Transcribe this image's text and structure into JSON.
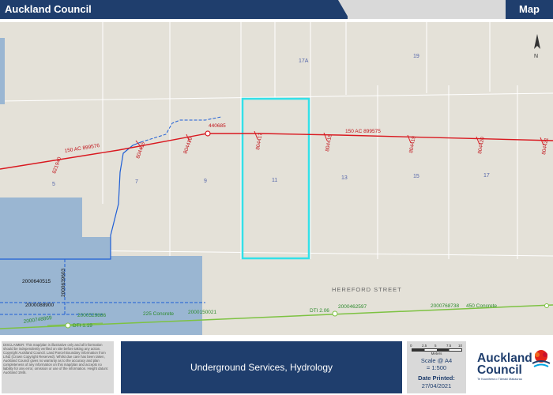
{
  "header": {
    "title": "Auckland Council",
    "tab_label": "Map"
  },
  "map": {
    "north_arrow_label": "N",
    "parcels": [
      "17A",
      "19",
      "5",
      "7",
      "9",
      "11",
      "13",
      "15",
      "17"
    ],
    "street_name": "HEREFORD STREET",
    "assets": {
      "a440685": "440685",
      "wastewater_west": "150 AC   899576",
      "wastewater_east": "150 AC   899575",
      "m821940": "821940",
      "m804415": "804415",
      "m804416": "804416",
      "m804417": "804417",
      "m804418": "804418",
      "m804419": "804419",
      "m804420": "804420",
      "m804421": "804421",
      "s2000640515": "2000640515",
      "s2000088900": "2000088900",
      "s2000639603": "2000639603",
      "w2000529886": "2000529886",
      "w225concrete": "225 Concrete",
      "w2000150021": "2000150021",
      "wdti206": "DTI 2.06",
      "w2000462597": "2000462597",
      "w2000768738": "2000768738",
      "w450concrete": "450 Concrete",
      "w2000748869": "2000748869",
      "wdti119": "DTI 1.19"
    },
    "colors": {
      "background": "#e4e1d8",
      "parcel_lines": "#ffffff",
      "water_area": "#9ab6d2",
      "wastewater": "#d9181f",
      "stormwater": "#1f5fd6",
      "water_supply": "#7dc242",
      "highlight": "#33e0e8"
    }
  },
  "footer": {
    "disclaimer": "DISCLAIMER: This map/plan is illustrative only and all information should be independently verified on site before taking any action. Copyright Auckland Council. Land Parcel Boundary information from LINZ (Crown Copyright Reserved). Whilst due care has been taken, Auckland Council gives no warranty as to the accuracy and plan completeness of any information on this map/plan and accepts no liability for any error, omission or use of the information. Height datum: Auckland 1946.",
    "title": "Underground Services, Hydrology",
    "scalebar_ticks": [
      "0",
      "2.5",
      "5",
      "7.5",
      "10"
    ],
    "scalebar_unit": "Meters",
    "scale_label": "Scale @ A4",
    "scale_value": "= 1:500",
    "date_label": "Date Printed:",
    "date_value": "27/04/2021",
    "logo_line1": "Auckland",
    "logo_line2": "Council",
    "logo_tagline": "Te Kaunihera o Tāmaki Makaurau"
  }
}
